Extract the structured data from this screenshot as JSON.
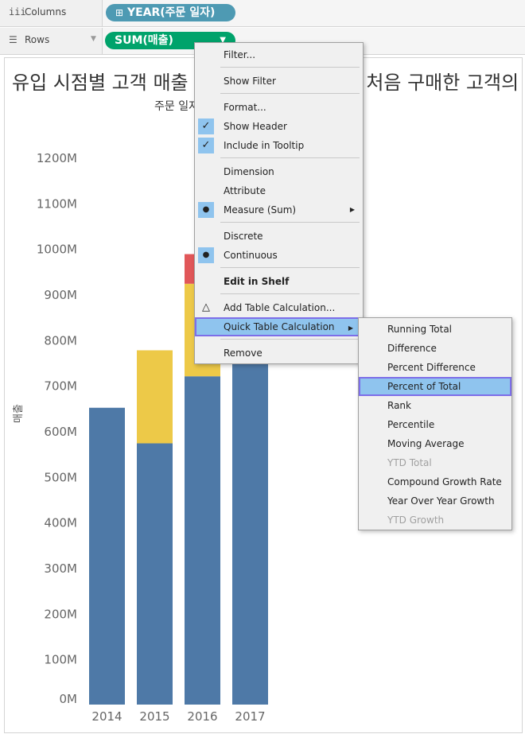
{
  "shelves": {
    "columns": {
      "icon": "columns-icon",
      "label": "Columns",
      "pill": "YEAR(주문 일자)",
      "pill_prefix": "⊞",
      "pill_color": "#4e9ab3"
    },
    "rows": {
      "icon": "rows-icon",
      "label": "Rows",
      "pill": "SUM(매출)",
      "pill_color": "#00a36b"
    }
  },
  "viz": {
    "title_left": "유입 시점별 고객 매출",
    "title_right": "에 처음 구매한 고객의",
    "column_header": "주문 일자"
  },
  "chart_data": {
    "type": "bar",
    "stacked": true,
    "categories": [
      "2014",
      "2015",
      "2016",
      "2017"
    ],
    "ylabel": "매출",
    "ylim": [
      0,
      1250
    ],
    "yticks": [
      "0M",
      "100M",
      "200M",
      "300M",
      "400M",
      "500M",
      "600M",
      "700M",
      "800M",
      "900M",
      "1000M",
      "1100M",
      "1200M"
    ],
    "ytick_values": [
      0,
      100,
      200,
      300,
      400,
      500,
      600,
      700,
      800,
      900,
      1000,
      1100,
      1200
    ],
    "series": [
      {
        "color": "#4e79a7",
        "values": [
          651,
          573,
          720,
          810
        ]
      },
      {
        "color": "#edc948",
        "values": [
          0,
          204,
          203,
          253
        ]
      },
      {
        "color": "#e15759",
        "values": [
          0,
          0,
          65,
          68
        ]
      },
      {
        "color": "#76b7b2",
        "values": [
          0,
          0,
          0,
          5
        ]
      }
    ]
  },
  "context_menu": {
    "items": [
      {
        "label": "Filter..."
      },
      {
        "label": "Show Filter"
      },
      {
        "label": "Format..."
      },
      {
        "label": "Show Header",
        "checked": true
      },
      {
        "label": "Include in Tooltip",
        "checked": true
      },
      {
        "label": "Dimension"
      },
      {
        "label": "Attribute"
      },
      {
        "label": "Measure (Sum)",
        "bullet": true,
        "submenu": true
      },
      {
        "label": "Discrete"
      },
      {
        "label": "Continuous",
        "bullet": true
      },
      {
        "label": "Edit in Shelf",
        "bold": true
      },
      {
        "label": "Add Table Calculation...",
        "icon": "delta-icon"
      },
      {
        "label": "Quick Table Calculation",
        "highlighted": true,
        "submenu": true
      },
      {
        "label": "Remove"
      }
    ]
  },
  "submenu": {
    "items": [
      {
        "label": "Running Total"
      },
      {
        "label": "Difference"
      },
      {
        "label": "Percent Difference"
      },
      {
        "label": "Percent of Total",
        "highlighted": true
      },
      {
        "label": "Rank"
      },
      {
        "label": "Percentile"
      },
      {
        "label": "Moving Average"
      },
      {
        "label": "YTD Total",
        "disabled": true
      },
      {
        "label": "Compound Growth Rate"
      },
      {
        "label": "Year Over Year Growth"
      },
      {
        "label": "YTD Growth",
        "disabled": true
      }
    ]
  },
  "colors": {
    "highlight_bg": "#8fc4ee",
    "highlight_border": "#7d6ee8"
  }
}
